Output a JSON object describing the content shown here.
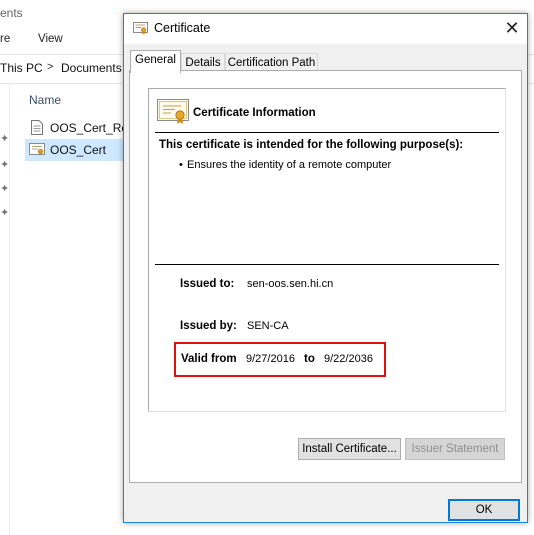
{
  "explorer": {
    "title_fragment": "ents",
    "menu": [
      "re",
      "View"
    ],
    "breadcrumb": [
      "This PC",
      "Documents"
    ],
    "breadcrumb_sep": ">",
    "column_header": "Name",
    "files": [
      {
        "name": "OOS_Cert_Req",
        "selected": false
      },
      {
        "name": "OOS_Cert",
        "selected": true
      }
    ]
  },
  "dialog": {
    "title": "Certificate",
    "close_glyph": "✕",
    "tabs": [
      "General",
      "Details",
      "Certification Path"
    ],
    "active_tab": 0,
    "info_title": "Certificate Information",
    "purpose_header": "This certificate is intended for the following purpose(s):",
    "purpose_bullet": "•",
    "purposes": [
      "Ensures the identity of a remote computer"
    ],
    "issued_to_label": "Issued to:",
    "issued_to_value": "sen-oos.sen.hi.cn",
    "issued_by_label": "Issued by:",
    "issued_by_value": "SEN-CA",
    "valid_from_label": "Valid from",
    "valid_from_value": "9/27/2016",
    "valid_to_label": "to",
    "valid_to_value": "9/22/2036",
    "buttons": {
      "install": "Install Certificate...",
      "issuer_statement": "Issuer Statement",
      "ok": "OK"
    },
    "highlight_color": "#e01010",
    "accent_color": "#0078d7"
  }
}
